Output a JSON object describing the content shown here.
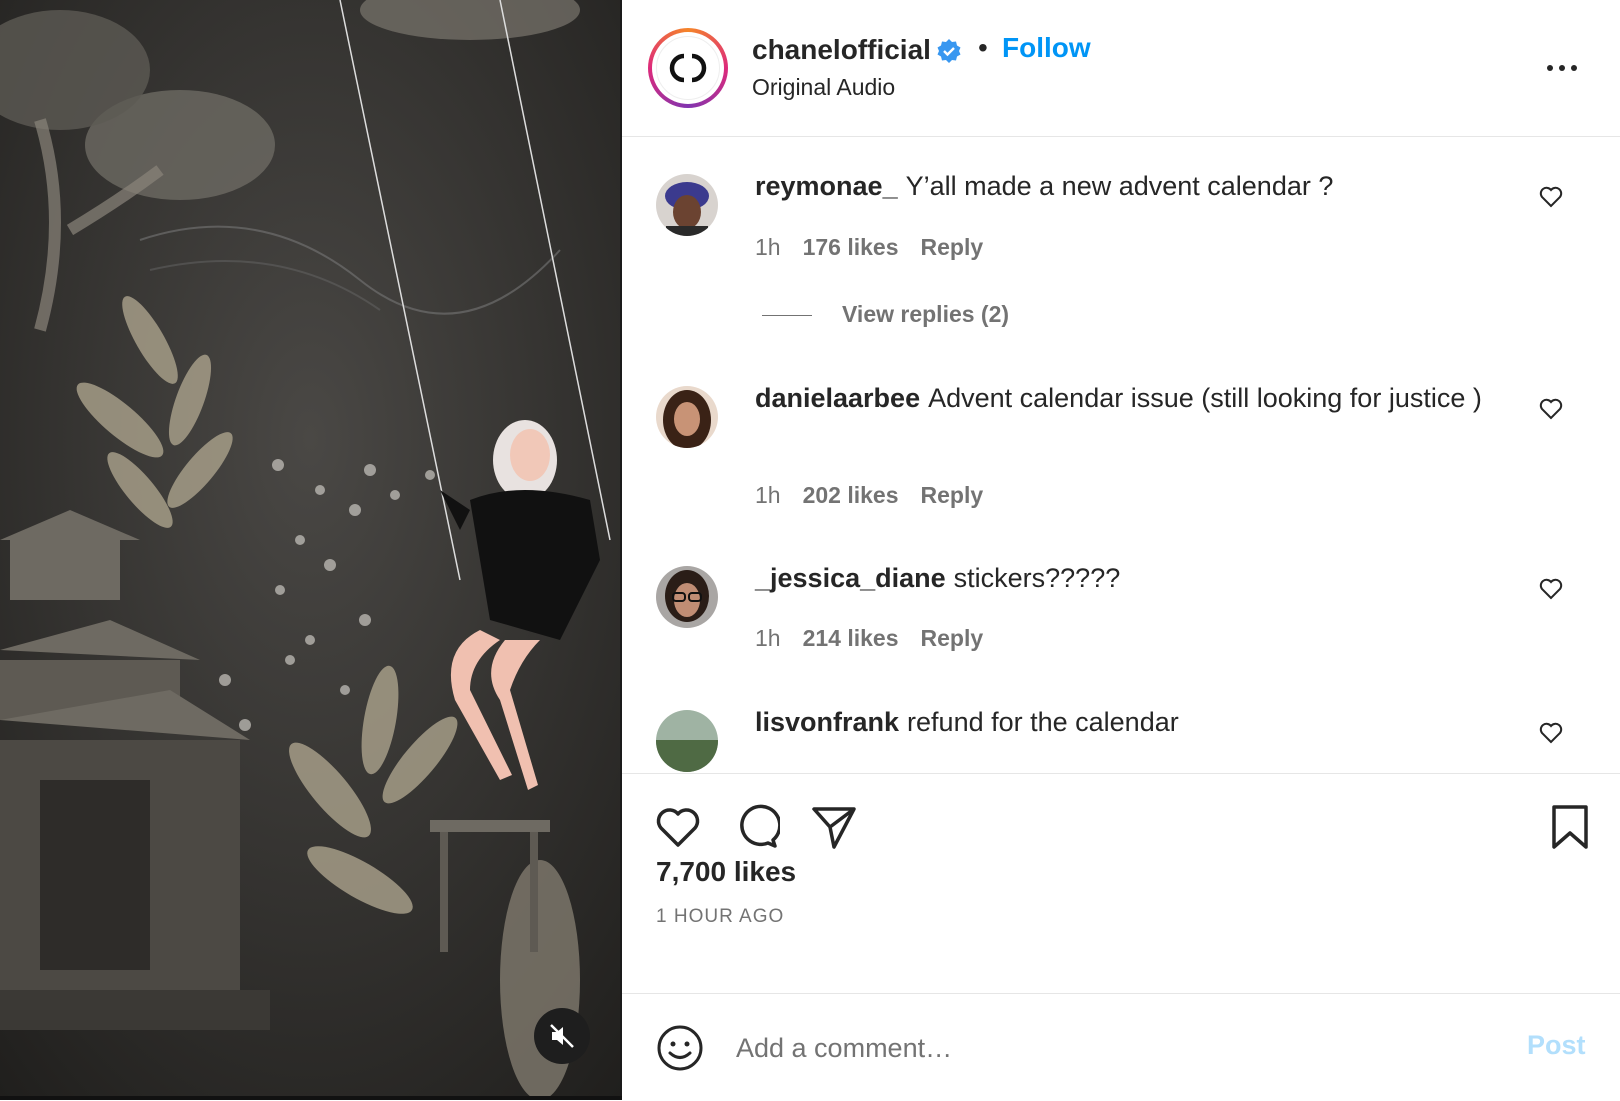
{
  "header": {
    "username": "chanelofficial",
    "verified_icon": "verified-badge-icon",
    "separator": "•",
    "follow_label": "Follow",
    "audio_label": "Original Audio",
    "more_icon": "more-options-icon"
  },
  "comments": [
    {
      "username": "reymonae_",
      "text": "Y’all made a new advent calendar ?",
      "time": "1h",
      "likes": "176 likes",
      "reply": "Reply",
      "view_replies": "View replies (2)"
    },
    {
      "username": "danielaarbee",
      "text": "Advent calendar issue (still looking for justice )",
      "time": "1h",
      "likes": "202 likes",
      "reply": "Reply"
    },
    {
      "username": "_jessica_diane",
      "text": "stickers?????",
      "time": "1h",
      "likes": "214 likes",
      "reply": "Reply"
    },
    {
      "username": "lisvonfrank",
      "text": "refund for the calendar"
    }
  ],
  "actions": {
    "likes": "7,700 likes",
    "time_ago": "1 HOUR AGO"
  },
  "add_comment": {
    "placeholder": "Add a comment…",
    "post_label": "Post"
  },
  "colors": {
    "accent": "#0095f6",
    "post_disabled": "#b2dffc",
    "secondary_text": "#737373"
  }
}
